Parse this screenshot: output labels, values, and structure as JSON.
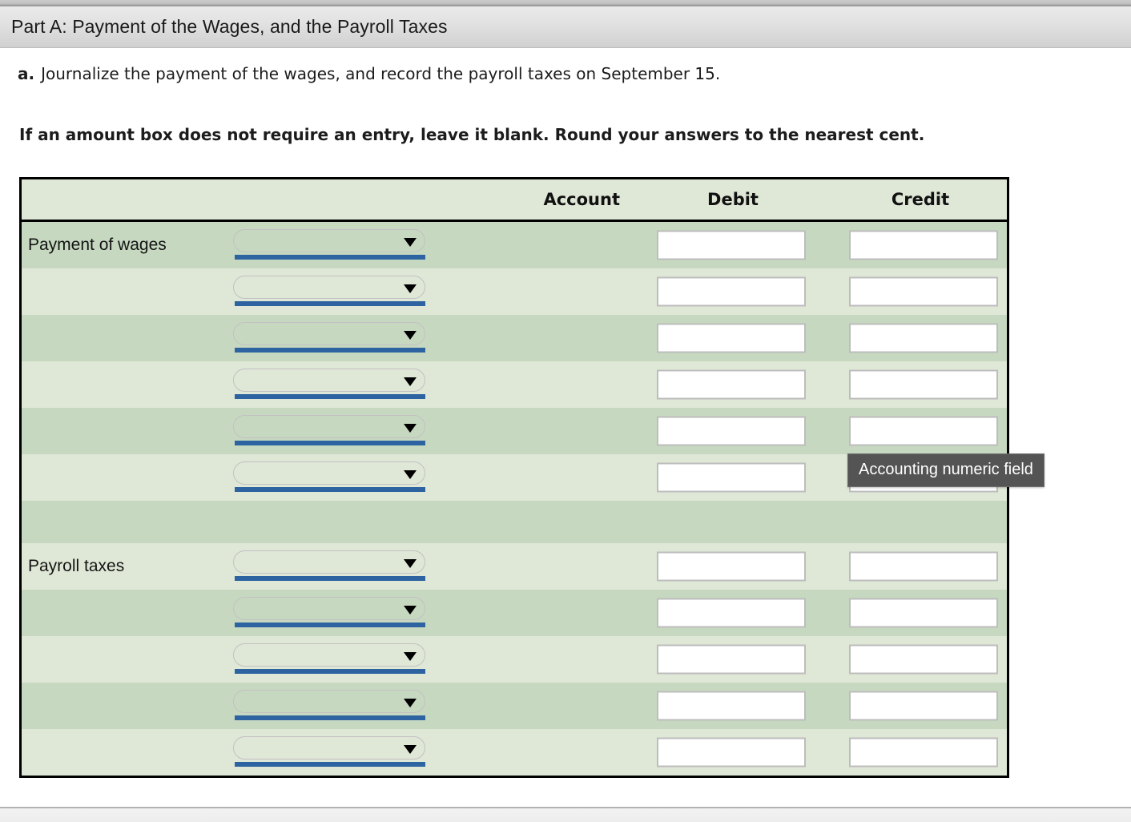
{
  "window": {
    "section_title": "Part A: Payment of the Wages, and the Payroll Taxes"
  },
  "instructions": {
    "item_label": "a.",
    "item_text": "Journalize the payment of the wages, and record the payroll taxes on September 15.",
    "note": "If an amount box does not require an entry, leave it blank. Round your answers to the nearest cent."
  },
  "journal": {
    "headers": {
      "row_label": "",
      "account": "Account",
      "debit": "Debit",
      "credit": "Credit"
    },
    "select_placeholder": "",
    "debit_value": "",
    "credit_value": "",
    "rows": [
      {
        "label": "Payment of wages",
        "stripe": "dark",
        "type": "entry",
        "account": "",
        "debit": "",
        "credit": ""
      },
      {
        "label": "",
        "stripe": "light",
        "type": "entry",
        "account": "",
        "debit": "",
        "credit": ""
      },
      {
        "label": "",
        "stripe": "dark",
        "type": "entry",
        "account": "",
        "debit": "",
        "credit": ""
      },
      {
        "label": "",
        "stripe": "light",
        "type": "entry",
        "account": "",
        "debit": "",
        "credit": ""
      },
      {
        "label": "",
        "stripe": "dark",
        "type": "entry",
        "account": "",
        "debit": "",
        "credit": ""
      },
      {
        "label": "",
        "stripe": "light",
        "type": "entry",
        "account": "",
        "debit": "",
        "credit": ""
      },
      {
        "label": "",
        "stripe": "dark",
        "type": "spacer"
      },
      {
        "label": "Payroll taxes",
        "stripe": "light",
        "type": "entry",
        "account": "",
        "debit": "",
        "credit": ""
      },
      {
        "label": "",
        "stripe": "dark",
        "type": "entry",
        "account": "",
        "debit": "",
        "credit": ""
      },
      {
        "label": "",
        "stripe": "light",
        "type": "entry",
        "account": "",
        "debit": "",
        "credit": ""
      },
      {
        "label": "",
        "stripe": "dark",
        "type": "entry",
        "account": "",
        "debit": "",
        "credit": ""
      },
      {
        "label": "",
        "stripe": "light",
        "type": "entry",
        "account": "",
        "debit": "",
        "credit": ""
      }
    ]
  },
  "tooltip": {
    "text": "Accounting numeric field"
  },
  "colors": {
    "stripe_dark": "#c6d8c0",
    "stripe_light": "#dfe8d7",
    "table_border": "#000000",
    "select_underline": "#2d63a0",
    "input_border": "#bdbdbd",
    "tooltip_bg": "#545454",
    "header_bar": "#e2e2e2"
  }
}
